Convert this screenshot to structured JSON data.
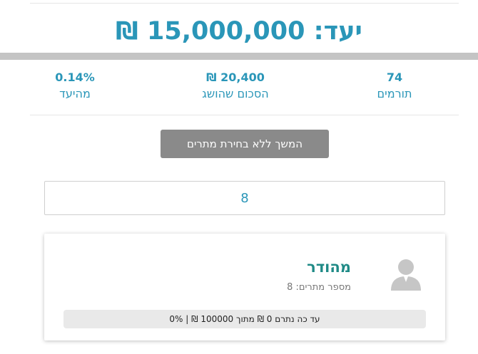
{
  "goal": {
    "text": "יעד: 15,000,000 ₪"
  },
  "stats": {
    "donors": {
      "value": "74",
      "label": "תורמים"
    },
    "raised": {
      "value": "20,400 ₪",
      "label": "הסכום שהושג"
    },
    "percent": {
      "value": "0.14%",
      "label": "מהיעד"
    }
  },
  "continue_button": {
    "label": "המשך ללא בחירת מתרים"
  },
  "amount_field": {
    "value": "8"
  },
  "card": {
    "name": "מהודר",
    "sub_label": "מספר מתרים:",
    "sub_value": "8",
    "progress_text": "עד כה נתרם 0 ₪ מתוך 100000 ₪ | 0%",
    "progress_fraction": 0
  },
  "colors": {
    "accent": "#2a96b8",
    "name": "#1f8a86",
    "button": "#8a8a8a"
  },
  "icons": {
    "avatar": "user-silhouette-icon"
  }
}
